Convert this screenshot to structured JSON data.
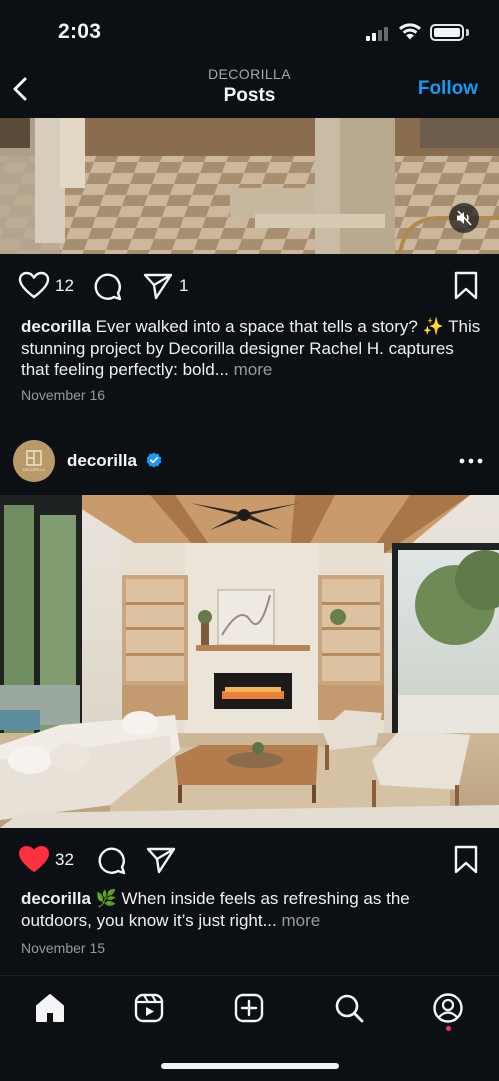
{
  "status": {
    "time": "2:03"
  },
  "nav": {
    "subtitle": "DECORILLA",
    "title": "Posts",
    "follow": "Follow"
  },
  "post1": {
    "likes": "12",
    "shares": "1",
    "caption_user": "decorilla",
    "caption_text": " Ever walked into a space that tells a story? ✨ This stunning project by Decorilla designer Rachel H. captures that feeling perfectly: bold...",
    "more": " more",
    "date": "November 16",
    "liked": false
  },
  "post2": {
    "username": "decorilla",
    "avatar_text": "DECORILLA",
    "likes": "32",
    "caption_user": "decorilla",
    "caption_text": " 🌿 When inside feels as refreshing as the outdoors, you know it’s just right...",
    "more": " more",
    "date": "November 15",
    "liked": true
  },
  "tabbar": {
    "items": [
      "home-icon",
      "reels-icon",
      "create-icon",
      "search-icon",
      "profile-icon"
    ],
    "active": "home-icon"
  },
  "colors": {
    "accent": "#1a99f0",
    "like": "#ff3040",
    "background": "#0c0f14"
  }
}
